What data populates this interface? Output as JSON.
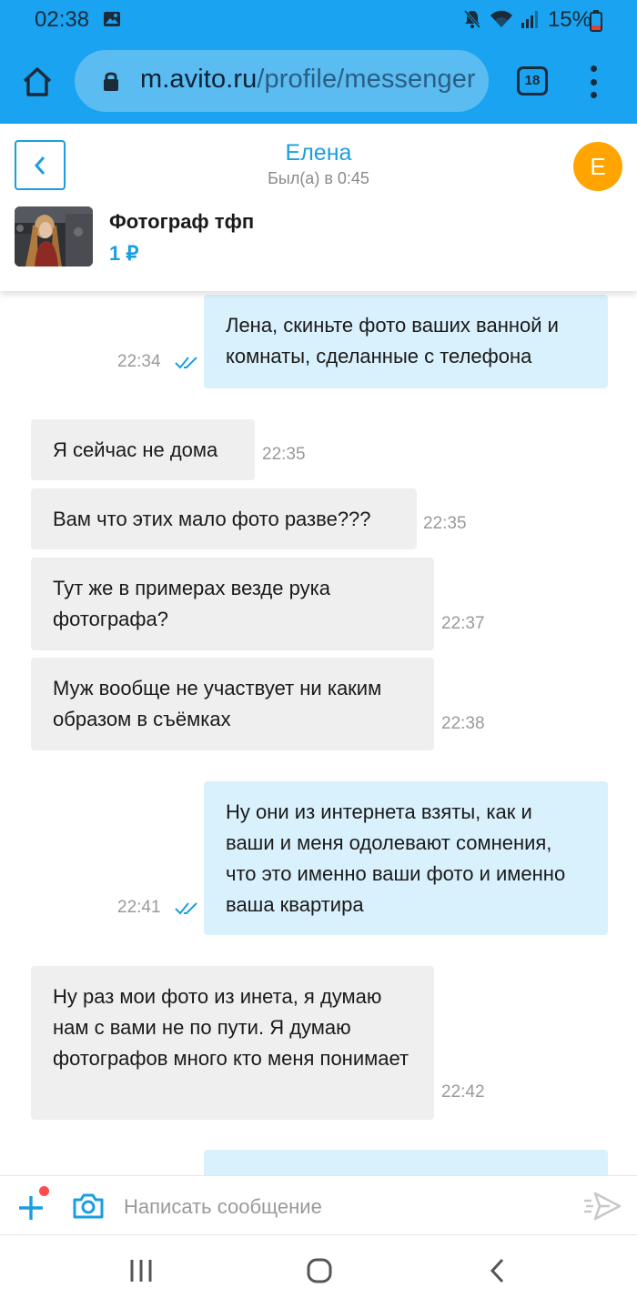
{
  "status_bar": {
    "time": "02:38",
    "battery": "15%"
  },
  "browser": {
    "url_host": "m.avito.ru",
    "url_path": "/profile/messenger",
    "tab_count": "18"
  },
  "chat_header": {
    "contact_name": "Елена",
    "last_seen": "Был(а) в 0:45",
    "avatar_letter": "Е",
    "listing_title": "Фотограф тфп",
    "listing_price": "1 ₽"
  },
  "messages": [
    {
      "direction": "out",
      "text": "Лена, скиньте фото ваших ванной и комнаты, сделанные с телефона",
      "time": "22:34",
      "read": true
    },
    {
      "direction": "in",
      "text": "Я сейчас не дома",
      "time": "22:35"
    },
    {
      "direction": "in",
      "text": "Вам что этих мало фото разве???",
      "time": "22:35"
    },
    {
      "direction": "in",
      "text": "Тут же в примерах везде рука фотографа?",
      "time": "22:37"
    },
    {
      "direction": "in",
      "text": "Муж вообще не участвует ни каким образом в съёмках",
      "time": "22:38"
    },
    {
      "direction": "out",
      "text": "Ну они из интернета взяты, как и ваши и меня одолевают сомнения, что это именно ваши фото и именно ваша квартира",
      "time": "22:41",
      "read": true
    },
    {
      "direction": "in",
      "text": "Ну раз мои фото из инета, я думаю нам с вами не по пути. Я думаю фотографов много кто меня понимает",
      "time": "22:42"
    }
  ],
  "composer": {
    "placeholder": "Написать сообщение"
  },
  "colors": {
    "browser_bar": "#1aa3f0",
    "accent": "#1a9ee0",
    "avatar": "#ffa400",
    "incoming_bubble": "#efefef",
    "outgoing_bubble": "#d9f1fd"
  },
  "icons": [
    "home-icon",
    "lock-icon",
    "tabs-icon",
    "menu-icon",
    "chevron-left-icon",
    "double-check-icon",
    "plus-icon",
    "camera-icon",
    "send-icon",
    "mute-icon",
    "wifi-icon",
    "signal-icon",
    "battery-icon",
    "gallery-icon"
  ]
}
